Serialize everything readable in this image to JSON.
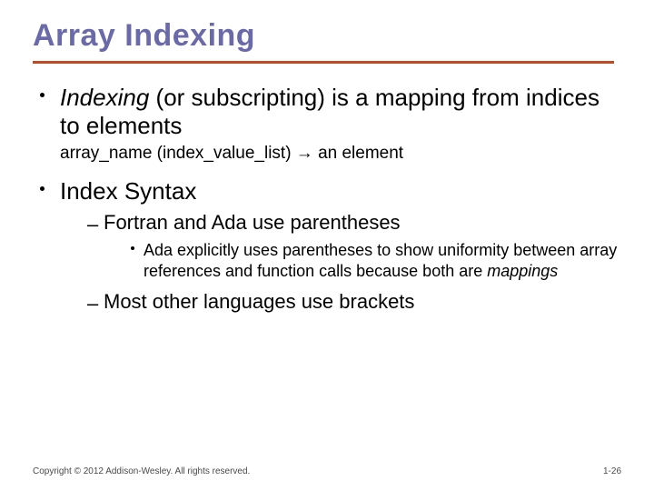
{
  "title": "Array Indexing",
  "bullets": {
    "b1": {
      "emph": "Indexing",
      "rest": " (or subscripting) is a mapping from indices to elements",
      "sub": "array_name (index_value_list) →  an element"
    },
    "b2": {
      "text": "Index Syntax",
      "children": {
        "c1": {
          "text": "Fortran and Ada use parentheses",
          "children": {
            "d1_pre": "Ada explicitly uses parentheses to show uniformity between array references and function calls because both are ",
            "d1_em": "mappings"
          }
        },
        "c2": {
          "text": "Most other languages use brackets"
        }
      }
    }
  },
  "footer": {
    "left": "Copyright © 2012 Addison-Wesley. All rights reserved.",
    "right": "1-26"
  }
}
